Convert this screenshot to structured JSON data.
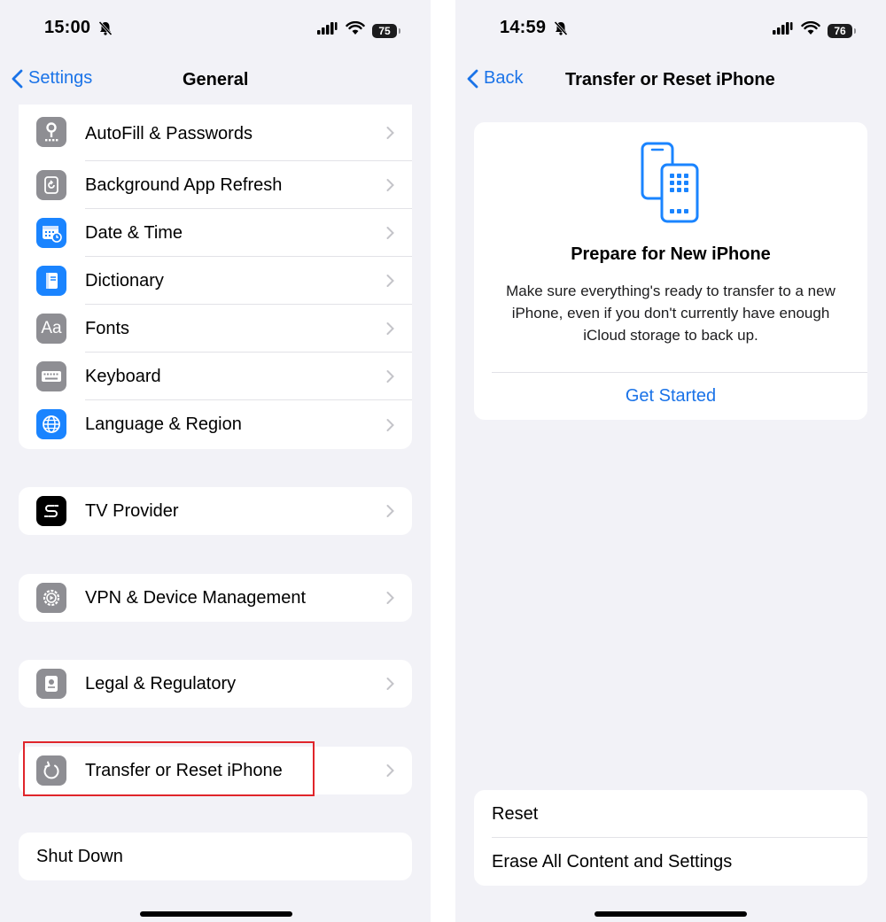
{
  "left": {
    "status": {
      "time": "15:00",
      "battery": "75"
    },
    "nav": {
      "back_label": "Settings",
      "title": "General"
    },
    "group1": [
      {
        "label": "AutoFill & Passwords",
        "icon": "key-icon"
      },
      {
        "label": "Background App Refresh",
        "icon": "refresh-icon"
      },
      {
        "label": "Date & Time",
        "icon": "calendar-clock-icon"
      },
      {
        "label": "Dictionary",
        "icon": "book-icon"
      },
      {
        "label": "Fonts",
        "icon": "fonts-icon",
        "glyph": "Aa"
      },
      {
        "label": "Keyboard",
        "icon": "keyboard-icon"
      },
      {
        "label": "Language & Region",
        "icon": "globe-icon"
      }
    ],
    "tv_provider": {
      "label": "TV Provider",
      "icon": "tv-provider-icon"
    },
    "vpn": {
      "label": "VPN & Device Management",
      "icon": "gear-icon"
    },
    "legal": {
      "label": "Legal & Regulatory",
      "icon": "certificate-icon"
    },
    "transfer": {
      "label": "Transfer or Reset iPhone",
      "icon": "reset-arrow-icon"
    },
    "shutdown": {
      "label": "Shut Down"
    }
  },
  "right": {
    "status": {
      "time": "14:59",
      "battery": "76"
    },
    "nav": {
      "back_label": "Back",
      "title": "Transfer or Reset iPhone"
    },
    "prepare": {
      "title": "Prepare for New iPhone",
      "body": "Make sure everything's ready to transfer to a new iPhone, even if you don't currently have enough iCloud storage to back up.",
      "button": "Get Started"
    },
    "reset": {
      "label": "Reset"
    },
    "erase": {
      "label": "Erase All Content and Settings"
    }
  },
  "colors": {
    "accent": "#1a73e8",
    "grey_icon": "#8e8e93",
    "blue_icon": "#1a84ff",
    "highlight": "#e0252b"
  }
}
